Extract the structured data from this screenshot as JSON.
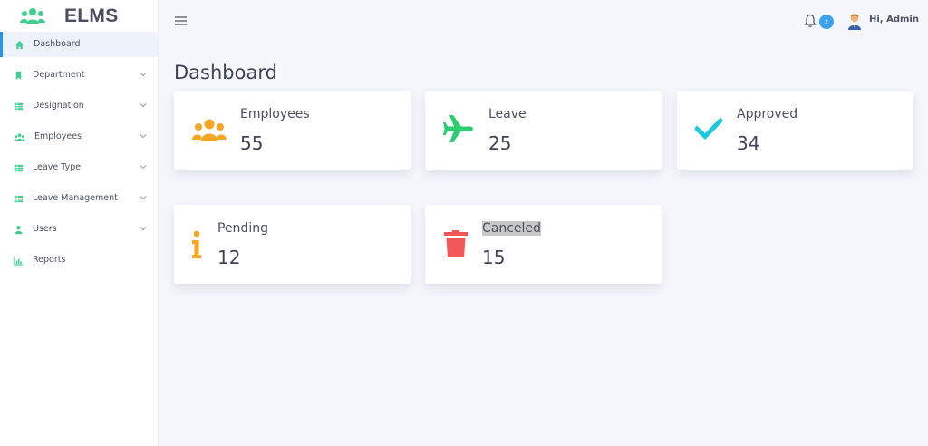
{
  "app": {
    "title": "ELMS"
  },
  "sidebar": {
    "items": [
      {
        "label": "Dashboard",
        "icon": "home-icon",
        "active": true
      },
      {
        "label": "Department",
        "icon": "bookmark-icon",
        "expandable": true
      },
      {
        "label": "Designation",
        "icon": "table-icon",
        "expandable": true
      },
      {
        "label": "Employees",
        "icon": "users-icon",
        "expandable": true
      },
      {
        "label": "Leave Type",
        "icon": "table-icon",
        "expandable": true
      },
      {
        "label": "Leave Management",
        "icon": "table-icon",
        "expandable": true
      },
      {
        "label": "Users",
        "icon": "user-icon",
        "expandable": true
      },
      {
        "label": "Reports",
        "icon": "chart-icon",
        "expandable": false
      }
    ]
  },
  "header": {
    "notification_count": "2",
    "greeting": "Hi, Admin"
  },
  "main": {
    "title": "Dashboard",
    "cards": [
      {
        "label": "Employees",
        "value": "55",
        "icon": "users-icon",
        "color": "#f5a623"
      },
      {
        "label": "Leave",
        "value": "25",
        "icon": "plane-icon",
        "color": "#2ecc71"
      },
      {
        "label": "Approved",
        "value": "34",
        "icon": "check-icon",
        "color": "#1cc8e0"
      },
      {
        "label": "Pending",
        "value": "12",
        "icon": "info-icon",
        "color": "#f5a623"
      },
      {
        "label": "Canceled",
        "value": "15",
        "icon": "trash-icon",
        "color": "#f25757"
      }
    ]
  },
  "colors": {
    "accent": "#2196f3",
    "sidebar_icon": "#3ecf8e",
    "background": "#f5f7fc"
  }
}
